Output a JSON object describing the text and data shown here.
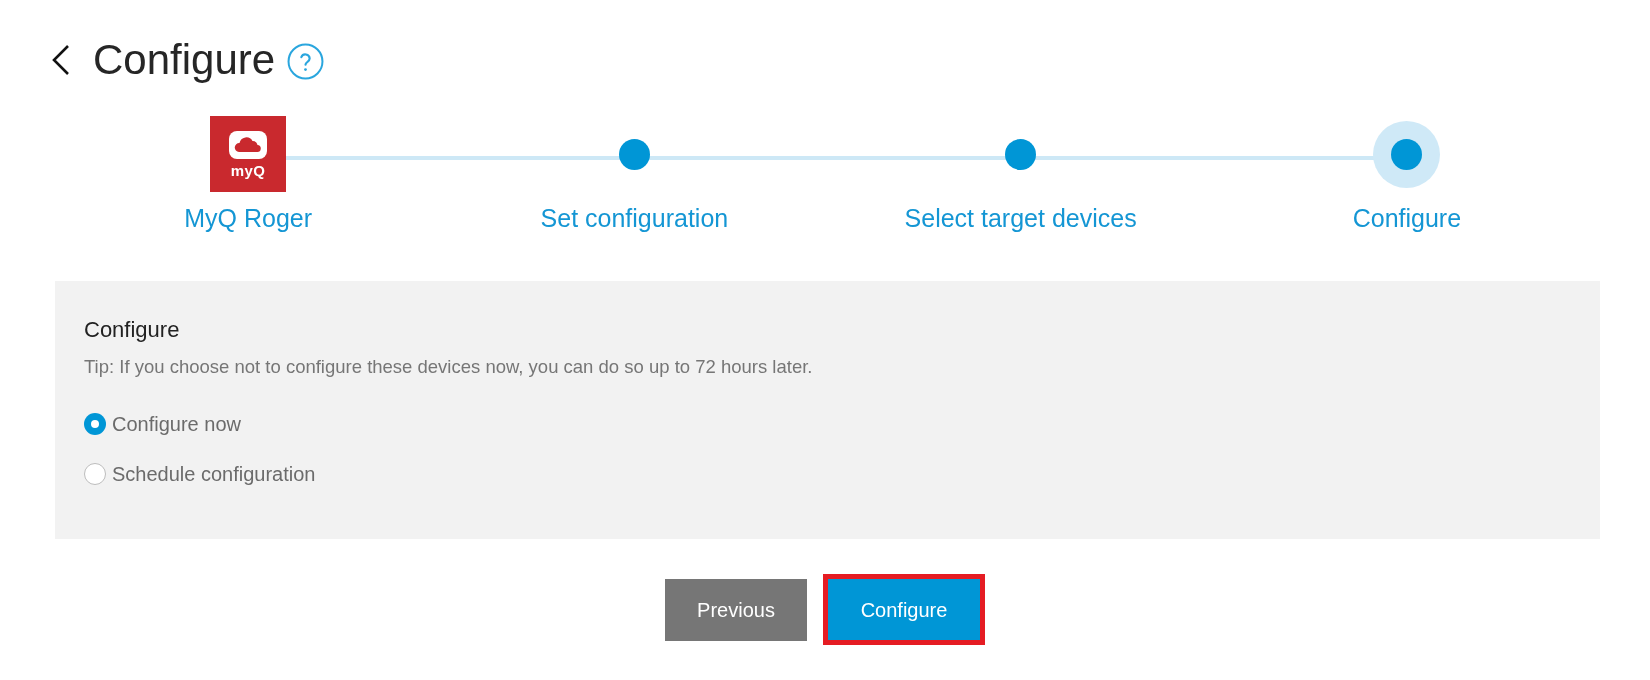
{
  "header": {
    "title": "Configure"
  },
  "steps": [
    {
      "kind": "logo",
      "logo_text": "myQ",
      "label": "MyQ Roger",
      "selected": false
    },
    {
      "kind": "dot",
      "label": "Set configuration",
      "selected": false
    },
    {
      "kind": "dot",
      "label": "Select target devices",
      "selected": false
    },
    {
      "kind": "dot",
      "label": "Configure",
      "selected": true
    }
  ],
  "panel": {
    "heading": "Configure",
    "tip": "Tip: If you choose not to configure these devices now, you can do so up to 72 hours later.",
    "options": [
      {
        "label": "Configure now",
        "selected": true
      },
      {
        "label": "Schedule configuration",
        "selected": false
      }
    ]
  },
  "buttons": [
    {
      "kind": "secondary",
      "label": "Previous",
      "highlighted": false
    },
    {
      "kind": "primary",
      "label": "Configure",
      "highlighted": true
    }
  ]
}
